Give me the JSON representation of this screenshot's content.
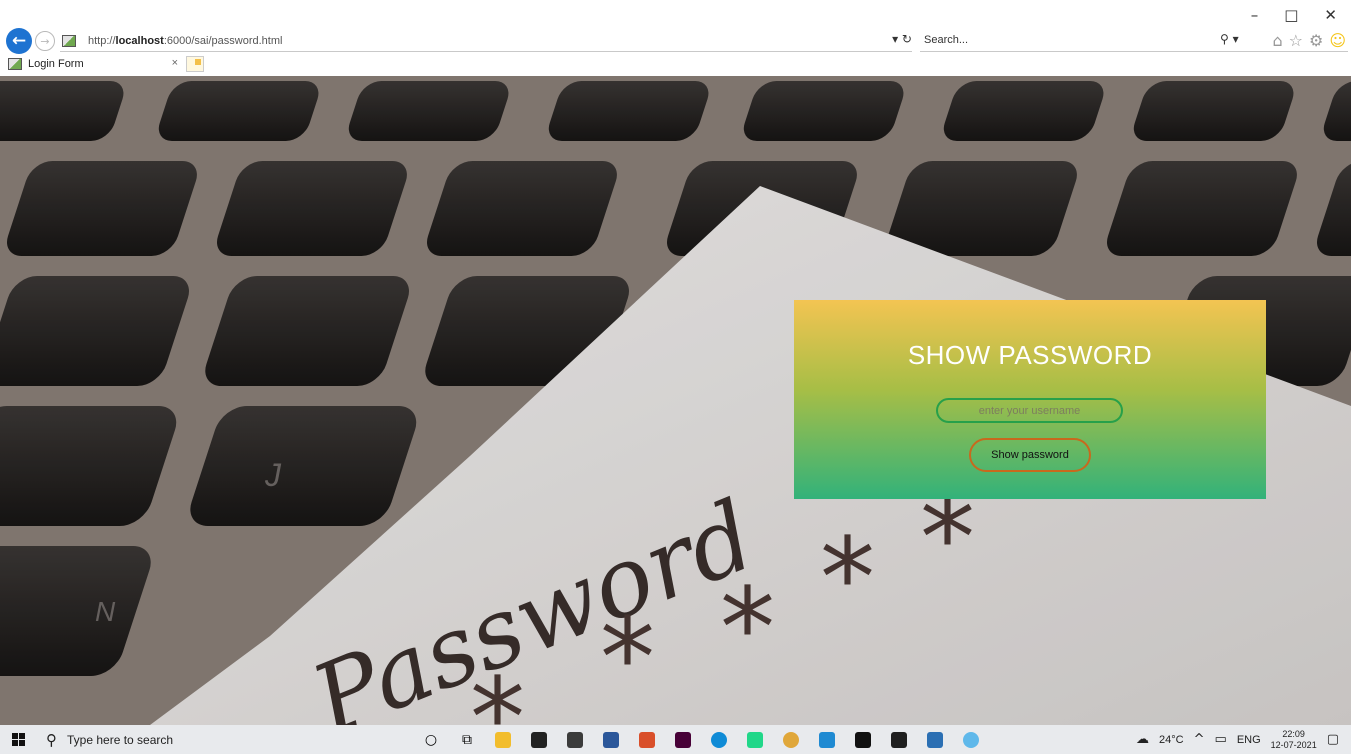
{
  "window": {
    "controls": {
      "minimize": "–",
      "maximize": "□",
      "close": "✕"
    }
  },
  "browser": {
    "url_prefix": "http://",
    "url_host": "localhost",
    "url_rest": ":6000/sai/password.html",
    "search_placeholder": "Search...",
    "address_tools": "▾ ↻",
    "search_tools": "⚲ ▾",
    "tab_title": "Login Form",
    "tab_close": "×"
  },
  "background": {
    "note_word": "Password",
    "key_letters": [
      "J",
      "N"
    ],
    "stars": [
      "*",
      "*",
      "*",
      "*",
      "*"
    ]
  },
  "login_panel": {
    "title": "SHOW PASSWORD",
    "username_placeholder": "enter your username",
    "button_label": "Show password",
    "accent_top": "#f3c452",
    "accent_bottom": "#32b27a"
  },
  "taskbar": {
    "search_placeholder": "Type here to search",
    "weather": "24°C",
    "language": "ENG",
    "time": "22:09",
    "date": "12-07-2021",
    "apps": [
      "cortana-icon",
      "task-view-icon",
      "file-explorer-icon",
      "store-icon",
      "mail-icon",
      "word-icon",
      "app-red-icon",
      "xd-icon",
      "edge-icon",
      "pycharm-icon",
      "chrome-icon",
      "vscode-icon",
      "terminal-icon",
      "photos-icon",
      "paint-icon",
      "ie-icon"
    ]
  }
}
